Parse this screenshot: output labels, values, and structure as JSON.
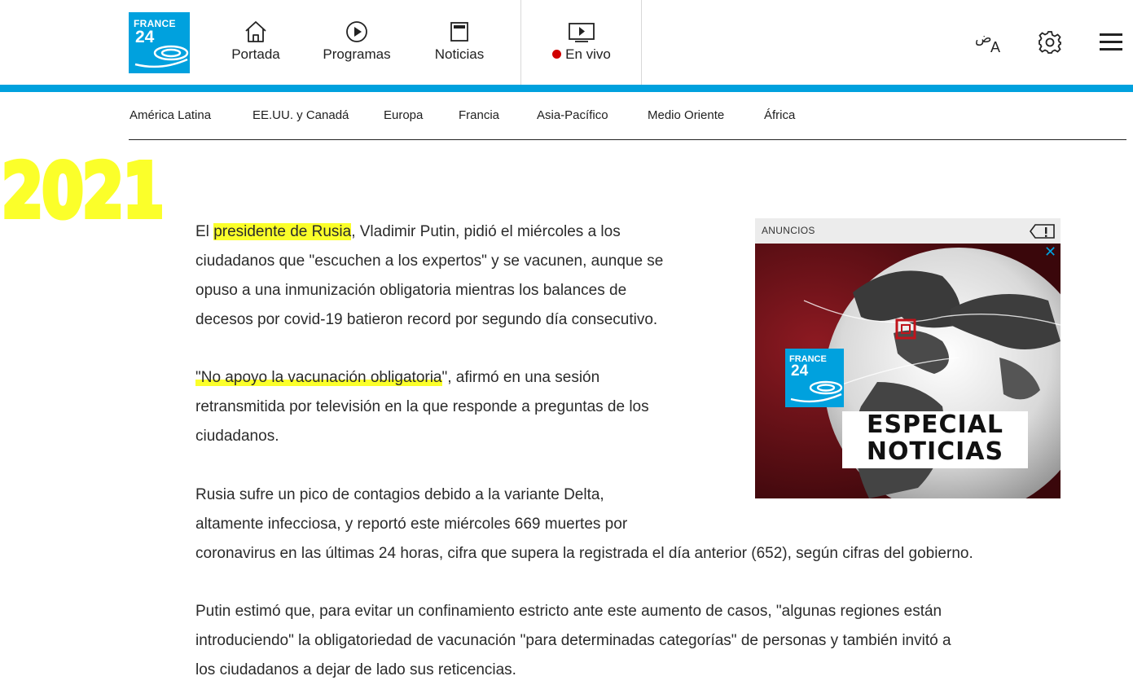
{
  "brand": {
    "logo_line1": "FRANCE",
    "logo_line2": "24"
  },
  "header": {
    "nav": [
      {
        "label": "Portada",
        "icon": "home-icon"
      },
      {
        "label": "Programas",
        "icon": "play-circle-icon"
      },
      {
        "label": "Noticias",
        "icon": "newspaper-icon"
      },
      {
        "label": "En vivo",
        "icon": "tv-play-icon"
      }
    ],
    "tools": [
      "language-icon",
      "gear-icon",
      "hamburger-menu-icon"
    ],
    "language_glyph_ar": "ض",
    "language_glyph_latin": "A"
  },
  "subnav": {
    "items": [
      "América Latina",
      "EE.UU. y Canadá",
      "Europa",
      "Francia",
      "Asia-Pacífico",
      "Medio Oriente",
      "África"
    ]
  },
  "annotation": {
    "year": "2021"
  },
  "article": {
    "p1_pre": "El ",
    "p1_hl": "presidente de Rusia",
    "p1_line1_post": ", Vladimir Putin, pidió el miércoles a los",
    "p1_line2": "ciudadanos que \"escuchen a los expertos\" y se vacunen, aunque se",
    "p1_line3": "opuso a una inmunización obligatoria mientras los balances de",
    "p1_line4": "decesos por covid-19 batieron record por segundo día consecutivo.",
    "p2_hl": "\"No apoyo la vacunación obligatoria",
    "p2_line1_post": "\", afirmó en una sesión",
    "p2_line2": "retransmitida por televisión en la que responde a preguntas de los",
    "p2_line3": "ciudadanos.",
    "p3_line1": "Rusia sufre un pico de contagios debido a la variante Delta,",
    "p3_line2": "altamente infecciosa, y reportó este miércoles 669 muertes por",
    "p3_line3": "coronavirus en las últimas 24 horas, cifra que supera la registrada el día anterior (652), según cifras del gobierno.",
    "p4_line1": "Putin estimó que, para evitar un confinamiento estricto ante este aumento de casos, \"algunas regiones están",
    "p4_line2": "introduciendo\" la obligatoriedad de vacunación \"para determinadas categorías\" de personas y también invitó a",
    "p4_line3": "los ciudadanos a dejar de lado sus reticencias."
  },
  "ad": {
    "label": "ANUNCIOS",
    "close": "✕",
    "logo_line1": "FRANCE",
    "logo_line2": "24",
    "line1": "ESPECIAL",
    "line2": "NOTICIAS"
  },
  "colors": {
    "brand_blue": "#00a1de",
    "live_red": "#d00000",
    "highlight_yellow": "#fbff2a",
    "ad_background": "#5a0d12"
  }
}
